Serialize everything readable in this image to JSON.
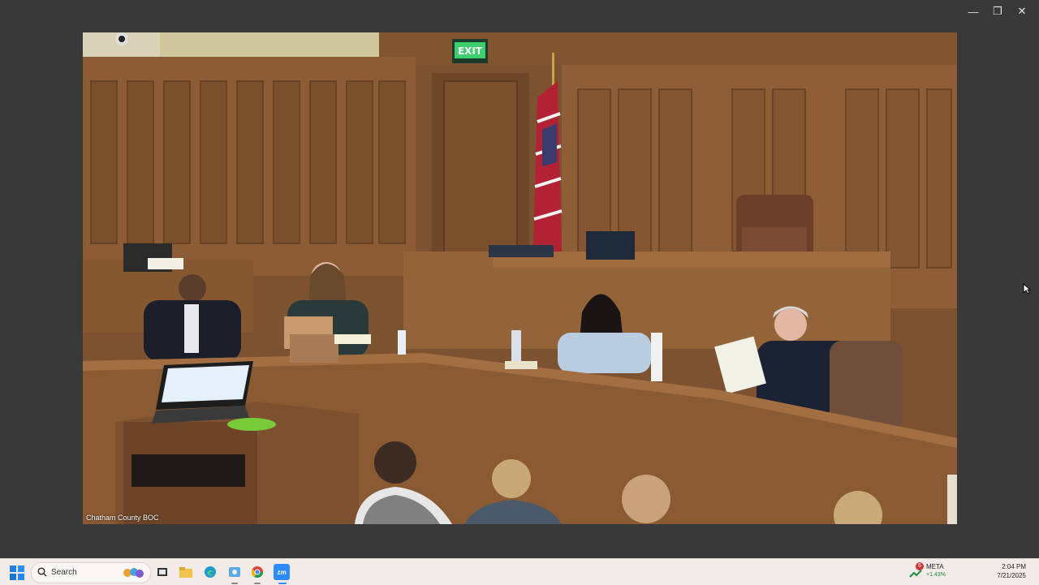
{
  "window": {
    "controls": {
      "minimize": "—",
      "restore": "❐",
      "close": "✕"
    }
  },
  "video": {
    "label": "Chatham County BOC",
    "exit_sign": "EXIT"
  },
  "taskbar": {
    "search_label": "Search",
    "apps": [
      "task-view-icon",
      "file-explorer-icon",
      "edge-icon",
      "photos-icon",
      "chrome-icon",
      "zoom-icon"
    ],
    "zoom_label": "zm",
    "stock": {
      "badge": "6",
      "ticker": "META",
      "change": "+1.43%"
    },
    "time": "2:04 PM",
    "date": "7/21/2025"
  },
  "colors": {
    "window_bg": "#393939",
    "taskbar_bg": "#f3ebe8",
    "wood": "#8a5a32",
    "accent_green": "#1b8a3e"
  }
}
